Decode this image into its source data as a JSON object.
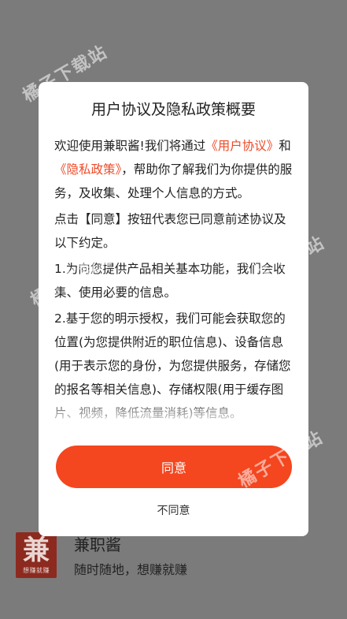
{
  "app": {
    "logo_char": "兼",
    "logo_slogan": "想赚就赚",
    "name": "兼职酱",
    "tagline": "随时随地，想赚就赚"
  },
  "watermark": "橘子下载站",
  "dialog": {
    "title": "用户协议及隐私政策概要",
    "p1_a": "欢迎使用兼职酱!我们将通过",
    "p1_link1": "《用户协议》",
    "p1_and": "和",
    "p1_link2": "《隐私政策》",
    "p1_b": "，帮助你了解我们为你提供的服务，及收集、处理个人信息的方式。",
    "p2": "点击【同意】按钮代表您已同意前述协议及以下约定。",
    "p3": "1.为向您提供产品相关基本功能，我们会收集、使用必要的信息。",
    "p4": "2.基于您的明示授权，我们可能会获取您的位置(为您提供附近的职位信息)、设备信息(用于表示您的身份，为您提供服务，存储您的报名等相关信息)、存储权限(用于缓存图片、视频，降低流量消耗)等信息。",
    "agree_label": "同意",
    "disagree_label": "不同意"
  },
  "colors": {
    "accent": "#f4461f",
    "link": "#ee4a27",
    "overlay": "#7b7b7b"
  }
}
